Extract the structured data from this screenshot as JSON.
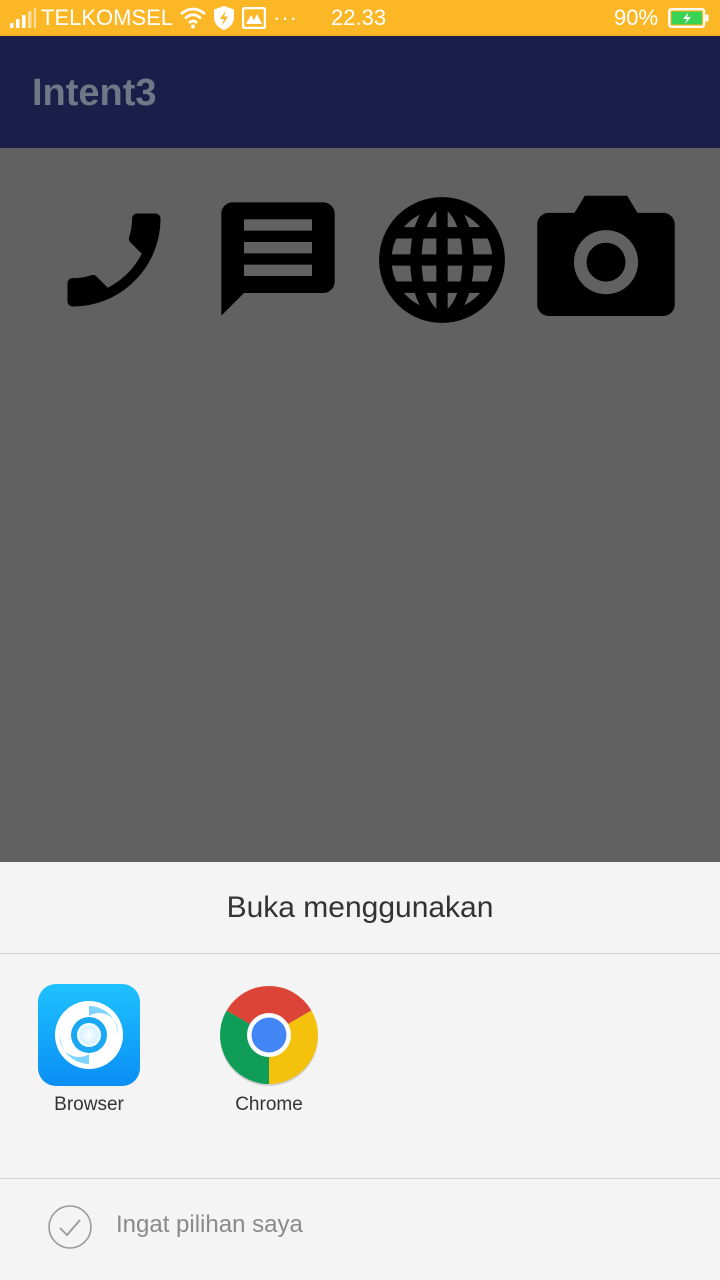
{
  "status_bar": {
    "carrier": "TELKOMSEL",
    "more": "···",
    "time": "22.33",
    "battery_percent": "90%",
    "battery_level": 0.9,
    "background_color": "#fcb727"
  },
  "app_bar": {
    "title": "Intent3",
    "background_color": "#1a1f4a"
  },
  "actions": [
    {
      "icon": "phone-icon"
    },
    {
      "icon": "message-icon"
    },
    {
      "icon": "globe-icon"
    },
    {
      "icon": "camera-icon"
    }
  ],
  "chooser": {
    "title": "Buka menggunakan",
    "apps": [
      {
        "label": "Browser",
        "icon": "browser-app-icon"
      },
      {
        "label": "Chrome",
        "icon": "chrome-app-icon"
      }
    ],
    "remember_label": "Ingat pilihan saya",
    "remember_checked": false
  }
}
